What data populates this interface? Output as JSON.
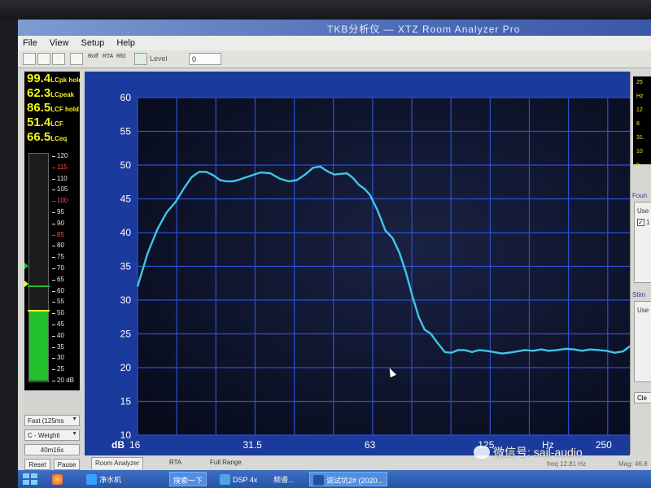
{
  "window": {
    "title": "TKB分析仪 — XTZ Room Analyzer Pro"
  },
  "menu": [
    {
      "label": "File"
    },
    {
      "label": "View"
    },
    {
      "label": "Setup"
    },
    {
      "label": "Help"
    }
  ],
  "toolbar": {
    "small_buttons": [
      "Roff",
      "RTA",
      "Rfd"
    ],
    "level_label": "Level",
    "level_value": "0"
  },
  "meter_readouts": [
    {
      "value": "99.4",
      "label": "LCpk hold"
    },
    {
      "value": "62.3",
      "label": "LCpeak"
    },
    {
      "value": "86.5",
      "label": "LCF hold"
    },
    {
      "value": "51.4",
      "label": "LCF"
    },
    {
      "value": "66.5",
      "label": "LCeq"
    }
  ],
  "meter": {
    "scale": [
      "120",
      "115",
      "110",
      "105",
      "100",
      "95",
      "90",
      "85",
      "80",
      "75",
      "70",
      "65",
      "60",
      "55",
      "50",
      "45",
      "40",
      "35",
      "30",
      "25",
      "20 dB"
    ],
    "red_scale_values": [
      "115",
      "100",
      "85"
    ],
    "scale_min": 20,
    "scale_max": 120,
    "level": 51.4,
    "peak": 62.3,
    "marker_levels": [
      71,
      63
    ],
    "fill_color": "#22c12b"
  },
  "meter_controls": {
    "speed": "Fast (125ms",
    "weighting": "C - Weighti",
    "duration": "40m16s",
    "reset": "Reset",
    "pause": "Pause"
  },
  "chart_data": {
    "type": "line",
    "y_ticks": [
      "60",
      "55",
      "50",
      "45",
      "40",
      "35",
      "30",
      "25",
      "20",
      "15",
      "10"
    ],
    "ylim": [
      10,
      60
    ],
    "x_tick_labels": [
      {
        "label": "16",
        "freq": 16
      },
      {
        "label": "31.5",
        "freq": 31.5
      },
      {
        "label": "63",
        "freq": 63
      },
      {
        "label": "125",
        "freq": 125
      },
      {
        "label": "250",
        "freq": 250
      }
    ],
    "x_unit_label": "Hz",
    "x_unit_freq": 180,
    "y_unit_label": "dB",
    "xlim": [
      16,
      315
    ],
    "x_scale": "log",
    "grid": true,
    "line_color": "#3fc6e8",
    "grid_color": "#2e4fd0",
    "series": [
      {
        "x": [
          16,
          17,
          18,
          19,
          20,
          21,
          22,
          23,
          24,
          25,
          26,
          27,
          28,
          29,
          30,
          31.5,
          33,
          35,
          37,
          39,
          41,
          43,
          45,
          47,
          49,
          51,
          53,
          55,
          57,
          59,
          61,
          63,
          66,
          69,
          72,
          75,
          78,
          81,
          84,
          87,
          90,
          94,
          98,
          102,
          106,
          110,
          115,
          120,
          125,
          131,
          137,
          143,
          150,
          157,
          165,
          173,
          181,
          190,
          200,
          210,
          220,
          231,
          242,
          254,
          267,
          280,
          294,
          308,
          315
        ],
        "y": [
          32,
          37,
          40.5,
          43,
          44.5,
          46.5,
          48.2,
          49,
          49,
          48.5,
          47.8,
          47.6,
          47.6,
          47.8,
          48.1,
          48.5,
          48.9,
          48.8,
          48,
          47.6,
          47.8,
          48.6,
          49.6,
          49.8,
          49.1,
          48.6,
          48.7,
          48.8,
          48.1,
          47.1,
          46.5,
          45.6,
          43.2,
          40.3,
          39.2,
          37,
          34,
          30.5,
          27.5,
          25.6,
          25.1,
          23.6,
          22.3,
          22.2,
          22.6,
          22.6,
          22.3,
          22.6,
          22.5,
          22.3,
          22.1,
          22.2,
          22.4,
          22.6,
          22.5,
          22.7,
          22.5,
          22.6,
          22.8,
          22.7,
          22.5,
          22.7,
          22.6,
          22.5,
          22.2,
          22.4,
          23.3,
          24,
          24.5
        ]
      }
    ]
  },
  "right_panel": {
    "readout_lines": [
      "25",
      "Hz",
      "12",
      "8",
      "31.",
      "10",
      "0."
    ],
    "found_label": "Foun",
    "use_label": "Use",
    "use_check_label": "1",
    "stim_label": "Stim",
    "stim_use_label": "Use",
    "clear_label": "Cle"
  },
  "tabs": [
    {
      "label": "Room Analyzer",
      "active": true
    },
    {
      "label": "RTA",
      "active": false
    },
    {
      "label": "Full Range",
      "active": false
    }
  ],
  "status": {
    "freq_label": "freq",
    "freq_value": "12.81 Hz",
    "mag_label": "Mag:",
    "mag_value": "46.8"
  },
  "taskbar": {
    "items": [
      "净水机",
      "搜索一下",
      "DSP 4x",
      "频谱...",
      "调试坑2# (2020..."
    ]
  },
  "watermark": {
    "text": "微信号: sail-audio"
  }
}
